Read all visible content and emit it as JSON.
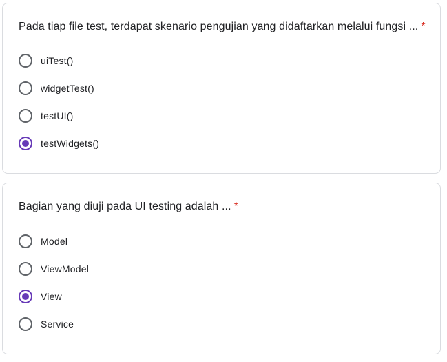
{
  "questions": [
    {
      "text": "Pada tiap file test, terdapat skenario pengujian yang didaftarkan melalui fungsi ...",
      "required_mark": "*",
      "options": [
        {
          "label": "uiTest()",
          "selected": false
        },
        {
          "label": "widgetTest()",
          "selected": false
        },
        {
          "label": "testUI()",
          "selected": false
        },
        {
          "label": "testWidgets()",
          "selected": true
        }
      ]
    },
    {
      "text": "Bagian yang diuji pada UI testing adalah ...",
      "required_mark": "*",
      "options": [
        {
          "label": "Model",
          "selected": false
        },
        {
          "label": "ViewModel",
          "selected": false
        },
        {
          "label": "View",
          "selected": true
        },
        {
          "label": "Service",
          "selected": false
        }
      ]
    }
  ],
  "colors": {
    "accent": "#673ab7",
    "required": "#d93025",
    "border": "#dadce0",
    "text": "#202124",
    "radio_unselected": "#5f6368"
  }
}
